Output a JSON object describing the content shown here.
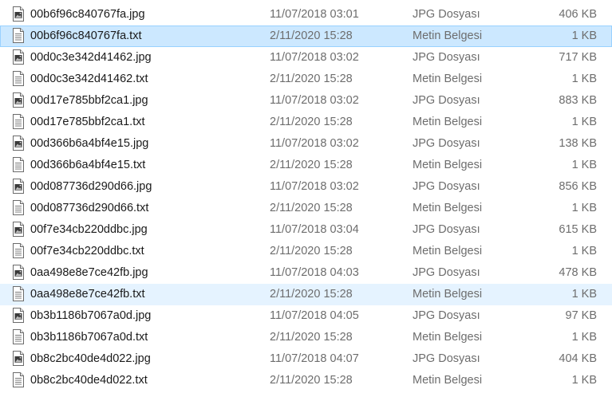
{
  "files": [
    {
      "name": "00b6f96c840767fa.jpg",
      "date": "11/07/2018 03:01",
      "type": "JPG Dosyası",
      "size": "406 KB",
      "icon": "image-file-icon",
      "state": ""
    },
    {
      "name": "00b6f96c840767fa.txt",
      "date": "2/11/2020 15:28",
      "type": "Metin Belgesi",
      "size": "1 KB",
      "icon": "text-file-icon",
      "state": "selected"
    },
    {
      "name": "00d0c3e342d41462.jpg",
      "date": "11/07/2018 03:02",
      "type": "JPG Dosyası",
      "size": "717 KB",
      "icon": "image-file-icon",
      "state": ""
    },
    {
      "name": "00d0c3e342d41462.txt",
      "date": "2/11/2020 15:28",
      "type": "Metin Belgesi",
      "size": "1 KB",
      "icon": "text-file-icon",
      "state": ""
    },
    {
      "name": "00d17e785bbf2ca1.jpg",
      "date": "11/07/2018 03:02",
      "type": "JPG Dosyası",
      "size": "883 KB",
      "icon": "image-file-icon",
      "state": ""
    },
    {
      "name": "00d17e785bbf2ca1.txt",
      "date": "2/11/2020 15:28",
      "type": "Metin Belgesi",
      "size": "1 KB",
      "icon": "text-file-icon",
      "state": ""
    },
    {
      "name": "00d366b6a4bf4e15.jpg",
      "date": "11/07/2018 03:02",
      "type": "JPG Dosyası",
      "size": "138 KB",
      "icon": "image-file-icon",
      "state": ""
    },
    {
      "name": "00d366b6a4bf4e15.txt",
      "date": "2/11/2020 15:28",
      "type": "Metin Belgesi",
      "size": "1 KB",
      "icon": "text-file-icon",
      "state": ""
    },
    {
      "name": "00d087736d290d66.jpg",
      "date": "11/07/2018 03:02",
      "type": "JPG Dosyası",
      "size": "856 KB",
      "icon": "image-file-icon",
      "state": ""
    },
    {
      "name": "00d087736d290d66.txt",
      "date": "2/11/2020 15:28",
      "type": "Metin Belgesi",
      "size": "1 KB",
      "icon": "text-file-icon",
      "state": ""
    },
    {
      "name": "00f7e34cb220ddbc.jpg",
      "date": "11/07/2018 03:04",
      "type": "JPG Dosyası",
      "size": "615 KB",
      "icon": "image-file-icon",
      "state": ""
    },
    {
      "name": "00f7e34cb220ddbc.txt",
      "date": "2/11/2020 15:28",
      "type": "Metin Belgesi",
      "size": "1 KB",
      "icon": "text-file-icon",
      "state": ""
    },
    {
      "name": "0aa498e8e7ce42fb.jpg",
      "date": "11/07/2018 04:03",
      "type": "JPG Dosyası",
      "size": "478 KB",
      "icon": "image-file-icon",
      "state": ""
    },
    {
      "name": "0aa498e8e7ce42fb.txt",
      "date": "2/11/2020 15:28",
      "type": "Metin Belgesi",
      "size": "1 KB",
      "icon": "text-file-icon",
      "state": "hover"
    },
    {
      "name": "0b3b1186b7067a0d.jpg",
      "date": "11/07/2018 04:05",
      "type": "JPG Dosyası",
      "size": "97 KB",
      "icon": "image-file-icon",
      "state": ""
    },
    {
      "name": "0b3b1186b7067a0d.txt",
      "date": "2/11/2020 15:28",
      "type": "Metin Belgesi",
      "size": "1 KB",
      "icon": "text-file-icon",
      "state": ""
    },
    {
      "name": "0b8c2bc40de4d022.jpg",
      "date": "11/07/2018 04:07",
      "type": "JPG Dosyası",
      "size": "404 KB",
      "icon": "image-file-icon",
      "state": ""
    },
    {
      "name": "0b8c2bc40de4d022.txt",
      "date": "2/11/2020 15:28",
      "type": "Metin Belgesi",
      "size": "1 KB",
      "icon": "text-file-icon",
      "state": ""
    }
  ]
}
